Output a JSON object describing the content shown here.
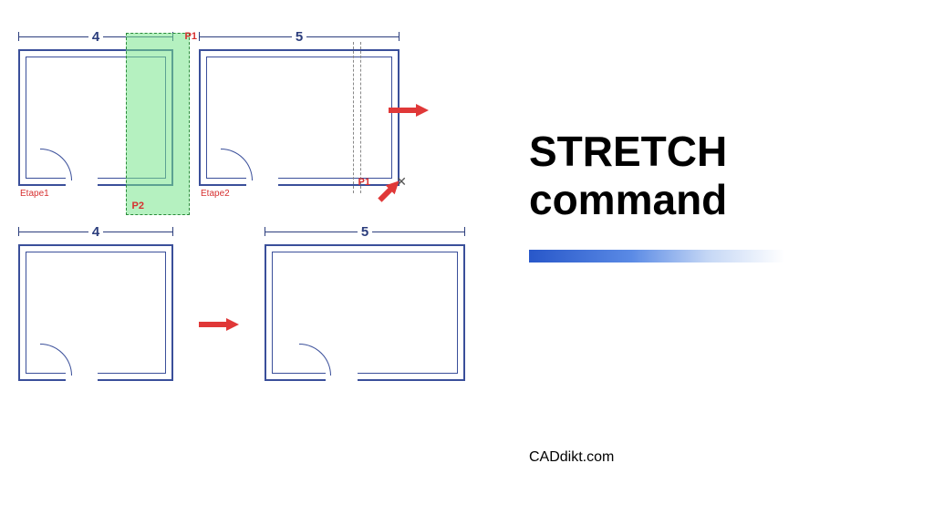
{
  "title_line1": "STRETCH",
  "title_line2": "command",
  "footer": "CADdikt.com",
  "diagrams": {
    "row1": {
      "box1": {
        "dim": "4",
        "label": "Etape1",
        "p1": "P1",
        "p2": "P2"
      },
      "box2": {
        "dim": "5",
        "label": "Etape2",
        "p1": "P1"
      }
    },
    "row2": {
      "box1": {
        "dim": "4"
      },
      "box2": {
        "dim": "5"
      }
    }
  }
}
